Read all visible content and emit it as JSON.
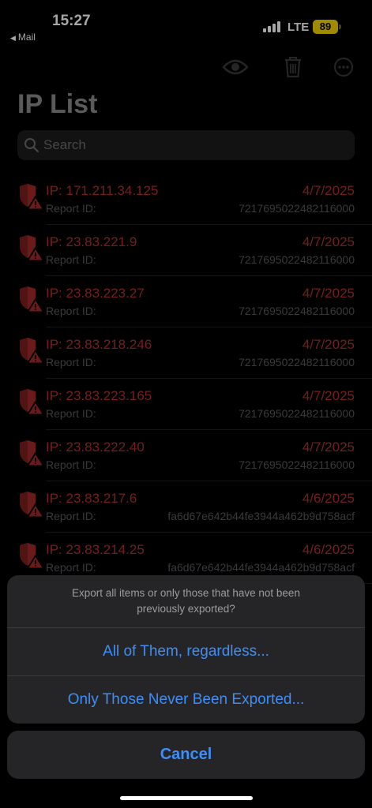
{
  "status_bar": {
    "time": "15:27",
    "back_app": "Mail",
    "network": "LTE",
    "battery": "89"
  },
  "toolbar": {
    "icons": [
      "eye-icon",
      "trash-icon",
      "more-icon"
    ]
  },
  "page": {
    "title": "IP List"
  },
  "search": {
    "placeholder": "Search"
  },
  "list": {
    "rows": [
      {
        "ip": "IP: 171.211.34.125",
        "date": "4/7/2025",
        "report_label": "Report ID:",
        "report_id": "7217695022482116000"
      },
      {
        "ip": "IP: 23.83.221.9",
        "date": "4/7/2025",
        "report_label": "Report ID:",
        "report_id": "7217695022482116000"
      },
      {
        "ip": "IP: 23.83.223.27",
        "date": "4/7/2025",
        "report_label": "Report ID:",
        "report_id": "7217695022482116000"
      },
      {
        "ip": "IP: 23.83.218.246",
        "date": "4/7/2025",
        "report_label": "Report ID:",
        "report_id": "7217695022482116000"
      },
      {
        "ip": "IP: 23.83.223.165",
        "date": "4/7/2025",
        "report_label": "Report ID:",
        "report_id": "7217695022482116000"
      },
      {
        "ip": "IP: 23.83.222.40",
        "date": "4/7/2025",
        "report_label": "Report ID:",
        "report_id": "7217695022482116000"
      },
      {
        "ip": "IP: 23.83.217.6",
        "date": "4/6/2025",
        "report_label": "Report ID:",
        "report_id": "fa6d67e642b44fe3944a462b9d758acf"
      },
      {
        "ip": "IP: 23.83.214.25",
        "date": "4/6/2025",
        "report_label": "Report ID:",
        "report_id": "fa6d67e642b44fe3944a462b9d758acf"
      }
    ]
  },
  "action_sheet": {
    "message": "Export all items or only those that have not been previously exported?",
    "option_all": "All of Them, regardless...",
    "option_new": "Only Those Never Been Exported...",
    "cancel": "Cancel"
  },
  "colors": {
    "accent_blue": "#3e8ef7",
    "alert_red": "#b3302e"
  }
}
